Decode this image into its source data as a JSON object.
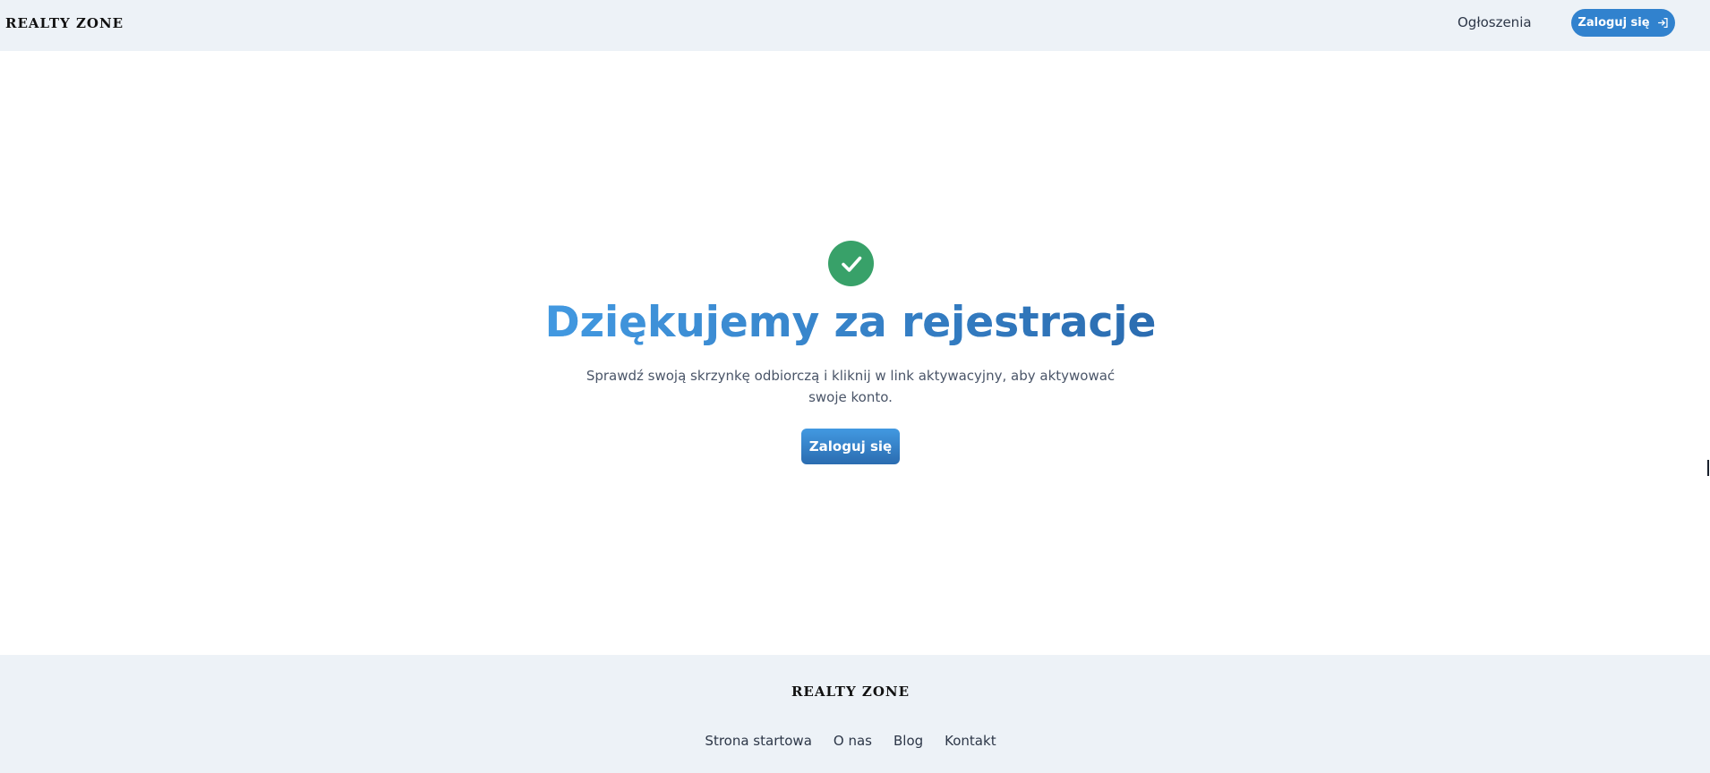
{
  "header": {
    "brand": "REALTY ZONE",
    "nav_link": "Ogłoszenia",
    "login_label": "Zaloguj się",
    "login_icon": "login-arrow-icon"
  },
  "main": {
    "status_icon": "check-circle-icon",
    "title": "Dziękujemy za rejestracje",
    "message": "Sprawdź swoją skrzynkę odbiorczą i kliknij w link aktywacyjny, aby aktywować swoje konto.",
    "login_label": "Zaloguj się"
  },
  "footer": {
    "brand": "REALTY ZONE",
    "links": [
      "Strona startowa",
      "O nas",
      "Blog",
      "Kontakt"
    ]
  },
  "colors": {
    "header_bg": "#edf2f7",
    "accent": "#3182ce",
    "success": "#38a169",
    "gradient_start": "#4299e1",
    "gradient_end": "#2b6cb0"
  }
}
